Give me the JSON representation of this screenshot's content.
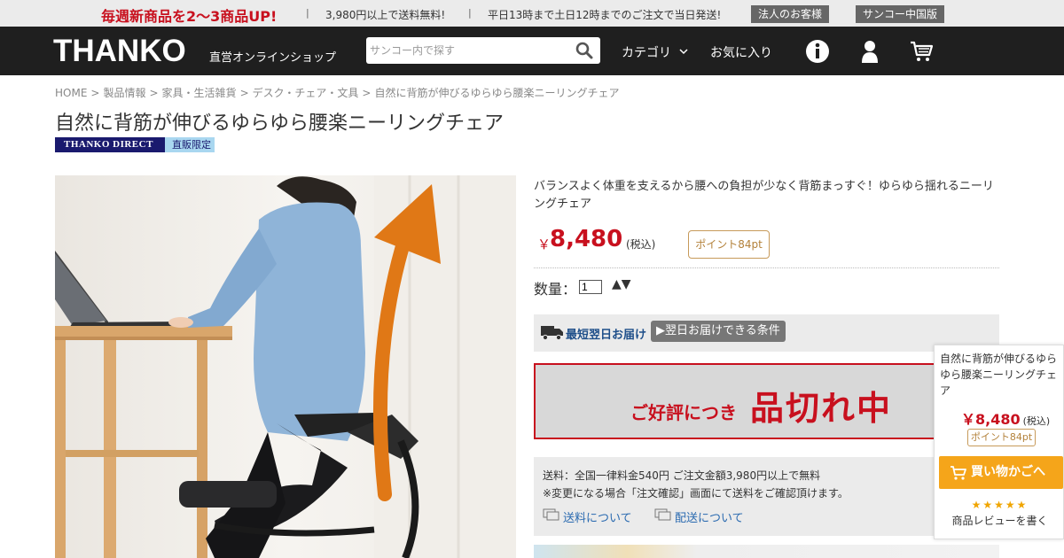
{
  "promo": {
    "headline": "毎週新商品を2～3商品UP!",
    "sep": "|",
    "shipping": "3,980円以上で送料無料!",
    "sameday": "平日13時まで土日12時までのご注文で当日発送!",
    "corporate": "法人のお客様",
    "china": "サンコー中国版"
  },
  "header": {
    "logo": "THANKO",
    "logo_sub": "直営オンラインショップ",
    "search_placeholder": "サンコー内で探す",
    "category": "カテゴリ",
    "favorites": "お気に入り",
    "icons": [
      "info-icon",
      "user-icon",
      "cart-icon"
    ]
  },
  "breadcrumb": [
    "HOME",
    "製品情報",
    "家具・生活雑貨",
    "デスク・チェア・文具",
    "自然に背筋が伸びるゆらゆら腰楽ニーリングチェア"
  ],
  "breadcrumb_sep": ">",
  "product": {
    "title": "自然に背筋が伸びるゆらゆら腰楽ニーリングチェア",
    "badge_brand": "THANKO DIRECT",
    "badge_label": "直販限定",
    "description": "バランスよく体重を支えるから腰への負担が少なく背筋まっすぐ！ゆらゆら揺れるニーリングチェア",
    "currency": "￥",
    "price": "8,480",
    "tax": "(税込)",
    "points": "ポイント84pt",
    "qty_label": "数量：",
    "qty_value": "1",
    "qty_arrows": "▲▼"
  },
  "delivery": {
    "fast": "最短翌日お届け",
    "conditions": "▶翌日お届けできる条件"
  },
  "soldout": {
    "prefix": "ご好評につき",
    "main": "品切れ中"
  },
  "fees": {
    "line1": "送料：全国一律料金540円 ご注文金額3,980円以上で無料",
    "line2": "※変更になる場合「注文確認」画面にて送料をご確認頂けます。",
    "link_shipping": "送料について",
    "link_delivery": "配送について"
  },
  "floating": {
    "title": "自然に背筋が伸びるゆらゆら腰楽ニーリングチェア",
    "price": "￥8,480",
    "tax": "(税込)",
    "points": "ポイント84pt",
    "cart": "買い物かごへ",
    "stars": "★★★★★",
    "review": "商品レビューを書く"
  },
  "colors": {
    "accent_red": "#c8101e",
    "header_bg": "#1f1f1f",
    "cart_orange": "#f5a51a",
    "link_blue": "#2a6ab0",
    "arrow_orange": "#e07816"
  }
}
